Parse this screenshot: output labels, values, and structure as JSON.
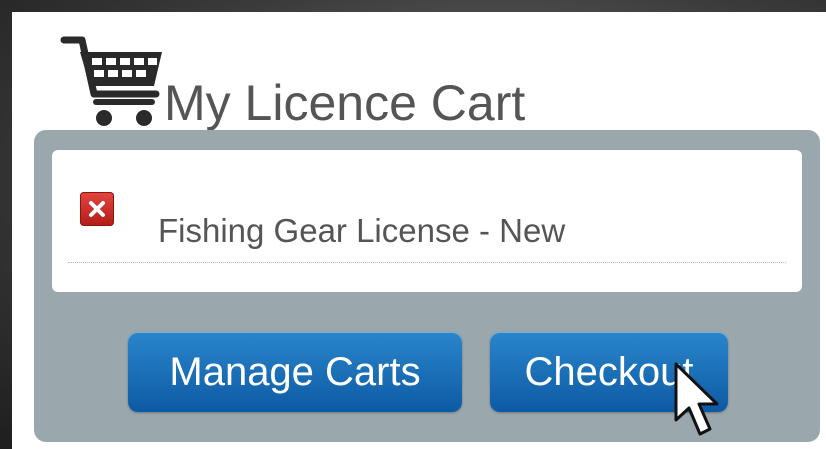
{
  "header": {
    "icon": "shopping-cart-icon",
    "title": "My Licence Cart"
  },
  "cart": {
    "items": [
      {
        "label": "Fishing Gear License - New",
        "remove_icon": "remove-x-icon"
      }
    ]
  },
  "actions": {
    "manage_label": "Manage Carts",
    "checkout_label": "Checkout"
  },
  "colors": {
    "button_blue": "#0d5aa3",
    "remove_red": "#c62a25",
    "cart_box_gray": "#9aa8ae",
    "title_gray": "#555555"
  },
  "cursor": "arrow-pointer-icon"
}
